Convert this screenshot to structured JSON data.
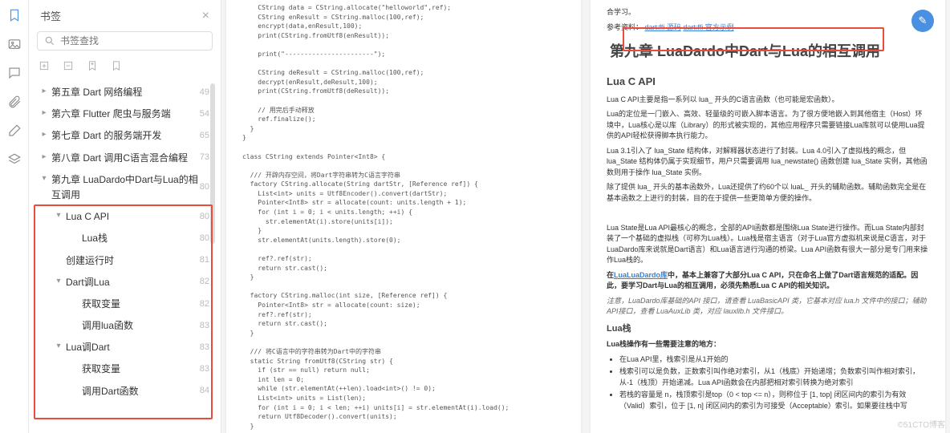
{
  "sidebar": {
    "title": "书签",
    "search_placeholder": "书签查找",
    "items": [
      {
        "label": "第五章 Dart 网络编程",
        "page": 49,
        "level": 0,
        "tw": "▸"
      },
      {
        "label": "第六章 Flutter 爬虫与服务端",
        "page": 54,
        "level": 0,
        "tw": "▸"
      },
      {
        "label": "第七章 Dart 的服务端开发",
        "page": 65,
        "level": 0,
        "tw": "▸"
      },
      {
        "label": "第八章 Dart 调用C语言混合编程",
        "page": 73,
        "level": 0,
        "tw": "▸"
      },
      {
        "label": "第九章 LuaDardo中Dart与Lua的相互调用",
        "page": 80,
        "level": 0,
        "tw": "▾"
      },
      {
        "label": "Lua C API",
        "page": 80,
        "level": 1,
        "tw": "▾"
      },
      {
        "label": "Lua栈",
        "page": 80,
        "level": 2,
        "tw": ""
      },
      {
        "label": "创建运行时",
        "page": 81,
        "level": 1,
        "tw": ""
      },
      {
        "label": "Dart调Lua",
        "page": 82,
        "level": 1,
        "tw": "▾"
      },
      {
        "label": "获取变量",
        "page": 82,
        "level": 2,
        "tw": ""
      },
      {
        "label": "调用lua函数",
        "page": 83,
        "level": 2,
        "tw": ""
      },
      {
        "label": "Lua调Dart",
        "page": 83,
        "level": 1,
        "tw": "▾"
      },
      {
        "label": "获取变量",
        "page": 83,
        "level": 2,
        "tw": ""
      },
      {
        "label": "调用Dart函数",
        "page": 84,
        "level": 2,
        "tw": ""
      }
    ]
  },
  "left_code": "    CString data = CString.allocate(\"helloworld\",ref);\n    CString enResult = CString.malloc(100,ref);\n    encrypt(data,enResult,100);\n    print(CString.fromUtf8(enResult));\n\n    print(\"-----------------------\");\n\n    CString deResult = CString.malloc(100,ref);\n    decrypt(enResult,deResult,100);\n    print(CString.fromUtf8(deResult));\n\n    // 用完后手动释放\n    ref.finalize();\n  }\n}\n\nclass CString extends Pointer<Int8> {\n\n  /// 开辟内存空间，将Dart字符串转为C语言字符串\n  factory CString.allocate(String dartStr, [Reference ref]) {\n    List<int> units = Utf8Encoder().convert(dartStr);\n    Pointer<Int8> str = allocate(count: units.length + 1);\n    for (int i = 0; i < units.length; ++i) {\n      str.elementAt(i).store(units[i]);\n    }\n    str.elementAt(units.length).store(0);\n\n    ref?.ref(str);\n    return str.cast();\n  }\n\n  factory CString.malloc(int size, [Reference ref]) {\n    Pointer<Int8> str = allocate(count: size);\n    ref?.ref(str);\n    return str.cast();\n  }\n\n  /// 将C语言中的字符串转为Dart中的字符串\n  static String fromUtf8(CString str) {\n    if (str == null) return null;\n    int len = 0;\n    while (str.elementAt(++len).load<int>() != 0);\n    List<int> units = List(len);\n    for (int i = 0; i < len; ++i) units[i] = str.elementAt(i).load();\n    return Utf8Decoder().convert(units);\n  }",
  "right": {
    "pretxt": "合学习。",
    "ref": "参考资料：",
    "link1": "dart:ffi 源码",
    "link2": "dart:ffi 官方示例",
    "h1": "第九章 LuaDardo中Dart与Lua的相互调用",
    "h2a": "Lua C API",
    "p1": "Lua C API主要是指一系列以 lua_ 开头的C语言函数（也可能是宏函数）。",
    "p2": "Lua的定位是一门嵌入、高效、轻量级的可嵌入脚本语言。为了很方便地嵌入到其他宿主（Host）环境中，Lua核心是以库（Library）的形式被实现的，其他应用程序只需要链接Lua库就可以使用Lua提供的API轻松获得脚本执行能力。",
    "p3": "Lua 3.1引入了 lua_State 结构体，对解释器状态进行了封装。Lua 4.0引入了虚拟栈的概念，但 lua_State 结构体仍属于实现细节，用户只需要调用 lua_newstate() 函数创建 lua_State 实例，其他函数则用于操作 lua_State 实例。",
    "p4": "除了提供 lua_ 开头的基本函数外，Lua还提供了约60个以 luaL_ 开头的辅助函数。辅助函数完全是在基本函数之上进行的封装，目的在于提供一些更简单方便的操作。",
    "p5": "Lua State是Lua API最核心的概念，全部的API函数都是围绕Lua State进行操作。而Lua State内部封装了一个基础的虚拟栈（可称为Lua栈）。Lua栈是宿主语言（对于Lua官方虚拟机来说是C语言，对于LuaDardo库来说就是Dart语言）和Lua语言进行沟通的桥梁。Lua API函数有很大一部分是专门用来操作Lua栈的。",
    "p6a": "在",
    "p6link": "LuaLuaDardo库",
    "p6b": "中，基本上兼容了大部分Lua C API，只在命名上做了Dart语言规范的适配。因此，要学习Dart与Lua的相互调用，必须先熟悉Lua C API的相关知识。",
    "note": "注意，LuaDardo库基础的API 接口，请查看 LuaBasicAPI 类，它基本对应 lua.h 文件中的接口；辅助API接口，查看 LuaAuxLib 类，对应 lauxlib.h 文件接口。",
    "h3": "Lua栈",
    "p7": "Lua栈操作有一些需要注意的地方：",
    "li1": "在Lua API里，栈索引是从1开始的",
    "li2": "栈索引可以是负数，正数索引叫作绝对索引，从1（栈底）开始递增；负数索引叫作相对索引，从-1（栈顶）开始递减。Lua API函数会在内部把相对索引转换为绝对索引",
    "li3": "若栈的容量是 n，栈顶索引是top（0 < top <= n），则称位于 [1, top] 闭区间内的索引为有效（Valid）索引，位于 [1, n] 闭区间内的索引为可接受（Acceptable）索引。如果要往栈中写"
  },
  "watermark": "©51CTO博客"
}
